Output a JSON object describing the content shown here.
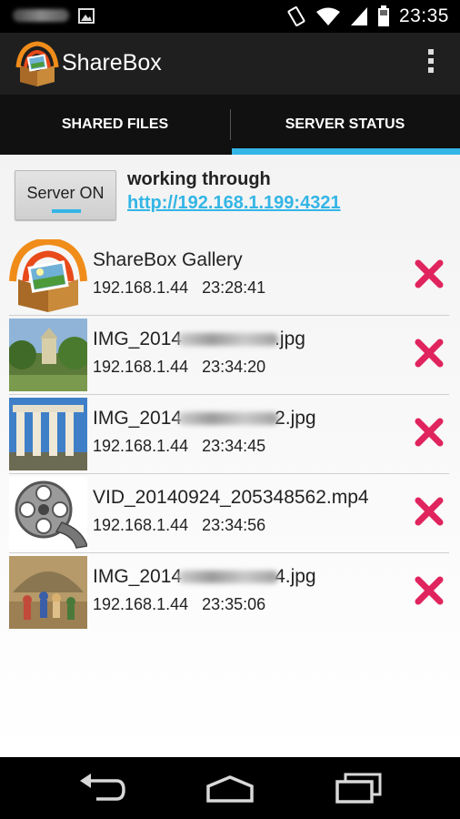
{
  "status_bar": {
    "time": "23:35",
    "icons": [
      "blurred-notification",
      "picture-icon",
      "vibrate-icon",
      "wifi-icon",
      "signal-icon",
      "battery-icon"
    ]
  },
  "action_bar": {
    "title": "ShareBox",
    "overflow_icon": "overflow-menu-icon"
  },
  "tabs": [
    {
      "label": "SHARED FILES",
      "selected": false
    },
    {
      "label": "SERVER STATUS",
      "selected": true
    }
  ],
  "server": {
    "button_label": "Server ON",
    "working_text": "working through",
    "url": "http://192.168.1.199:4321"
  },
  "files": [
    {
      "name": "ShareBox Gallery",
      "name_prefix": "",
      "name_suffix": "",
      "ip": "192.168.1.44",
      "time": "23:28:41",
      "thumb": "sharebox-logo"
    },
    {
      "name": "",
      "name_prefix": "IMG_2014",
      "name_suffix": ".jpg",
      "ip": "192.168.1.44",
      "time": "23:34:20",
      "thumb": "garden-photo"
    },
    {
      "name": "",
      "name_prefix": "IMG_2014",
      "name_suffix": "2.jpg",
      "ip": "192.168.1.44",
      "time": "23:34:45",
      "thumb": "columns-photo"
    },
    {
      "name": "VID_20140924_205348562.mp4",
      "name_prefix": "",
      "name_suffix": "",
      "ip": "192.168.1.44",
      "time": "23:34:56",
      "thumb": "film-reel"
    },
    {
      "name": "",
      "name_prefix": "IMG_2014",
      "name_suffix": "4.jpg",
      "ip": "192.168.1.44",
      "time": "23:35:06",
      "thumb": "painting-photo"
    }
  ],
  "colors": {
    "accent": "#33b5e5",
    "delete": "#e0245e",
    "tab_bar": "#111111",
    "action_bar": "#1f1f1f"
  }
}
